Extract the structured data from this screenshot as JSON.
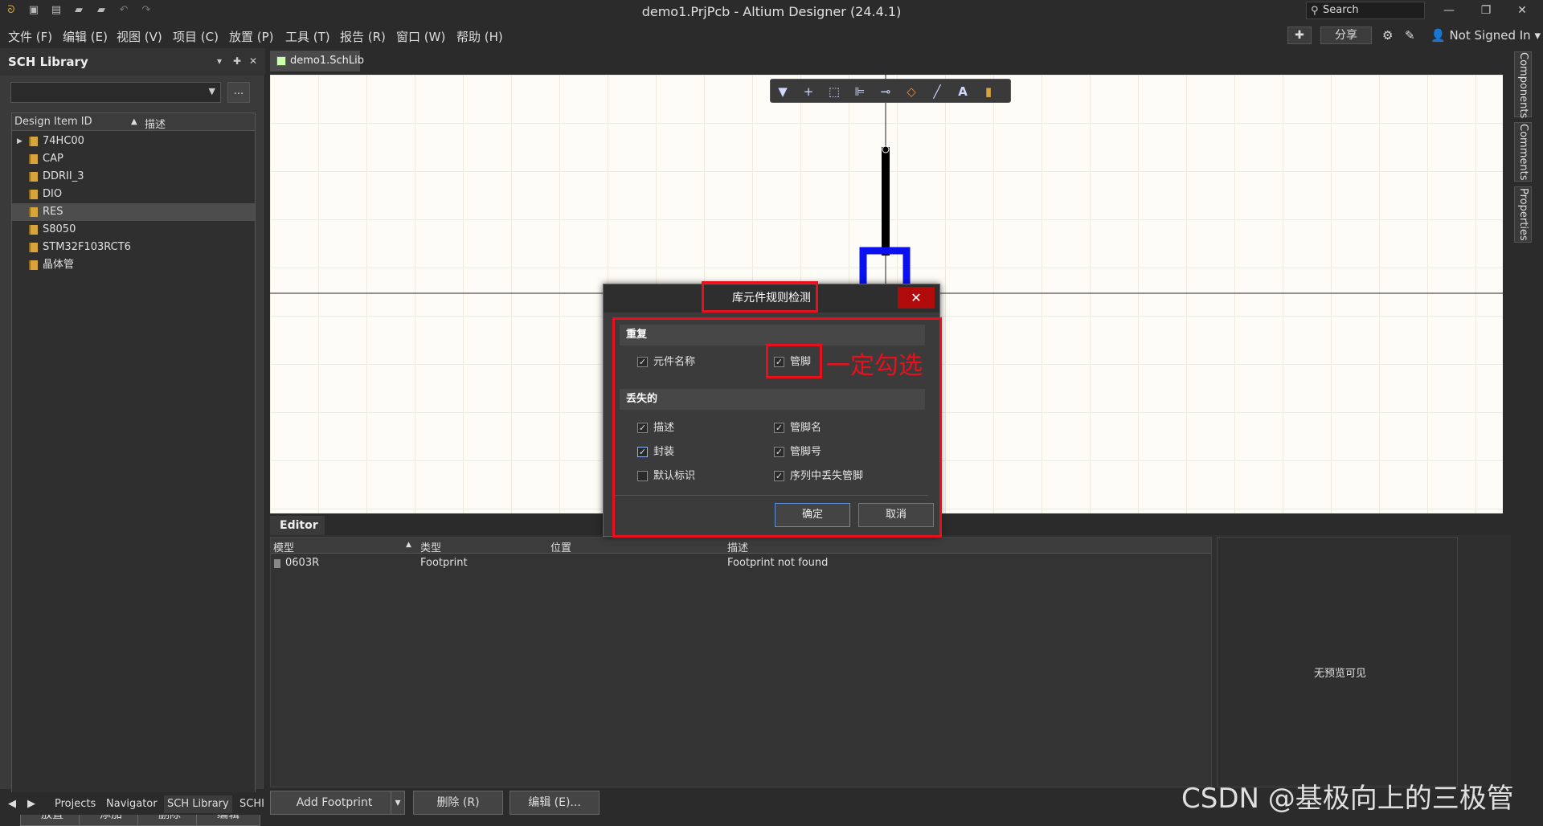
{
  "titlebar": {
    "title": "demo1.PrjPcb - Altium Designer (24.4.1)",
    "search_placeholder": "Search"
  },
  "menu": [
    "文件 (F)",
    "编辑 (E)",
    "视图 (V)",
    "项目 (C)",
    "放置 (P)",
    "工具 (T)",
    "报告 (R)",
    "窗口 (W)",
    "帮助 (H)"
  ],
  "menu_right": {
    "share": "分享",
    "signin": "Not Signed In"
  },
  "left_panel": {
    "title": "SCH Library",
    "dots": "...",
    "col_id": "Design Item ID",
    "col_desc": "描述",
    "items": [
      "74HC00",
      "CAP",
      "DDRII_3",
      "DIO",
      "RES",
      "S8050",
      "STM32F103RCT6",
      "晶体管"
    ],
    "selected": "RES",
    "buttons": [
      "放置",
      "添加",
      "删除",
      "编辑"
    ]
  },
  "nav_tabs": [
    "Projects",
    "Navigator",
    "SCH Library",
    "SCHI"
  ],
  "doc_tab": "demo1.SchLib",
  "editor": {
    "tab": "Editor",
    "columns": [
      "模型",
      "类型",
      "位置",
      "描述"
    ],
    "row": {
      "model": "0603R",
      "type": "Footprint",
      "position": "",
      "desc": "Footprint not found"
    },
    "preview_text": "无预览可见",
    "add_footprint": "Add Footprint",
    "delete": "删除 (R)",
    "edit": "编辑 (E)..."
  },
  "right_tabs": [
    "Components",
    "Comments",
    "Properties"
  ],
  "dialog": {
    "title": "库元件规则检测",
    "close": "✕",
    "section_duplicate": "重复",
    "section_missing": "丢失的",
    "checks": {
      "component_name": {
        "label": "元件名称",
        "checked": true
      },
      "pins": {
        "label": "管脚",
        "checked": true
      },
      "description": {
        "label": "描述",
        "checked": true
      },
      "pin_name": {
        "label": "管脚名",
        "checked": true
      },
      "footprint": {
        "label": "封装",
        "checked": true
      },
      "pin_number": {
        "label": "管脚号",
        "checked": true
      },
      "default_designator": {
        "label": "默认标识",
        "checked": false
      },
      "missing_pins_in_sequence": {
        "label": "序列中丢失管脚",
        "checked": true
      }
    },
    "ok": "确定",
    "cancel": "取消"
  },
  "annotation": "一定勾选",
  "watermark": "CSDN @基极向上的三极管",
  "colors": {
    "highlight_red": "#e8101c",
    "close_red": "#b00a0a",
    "pin_blue": "#0a10f0"
  }
}
